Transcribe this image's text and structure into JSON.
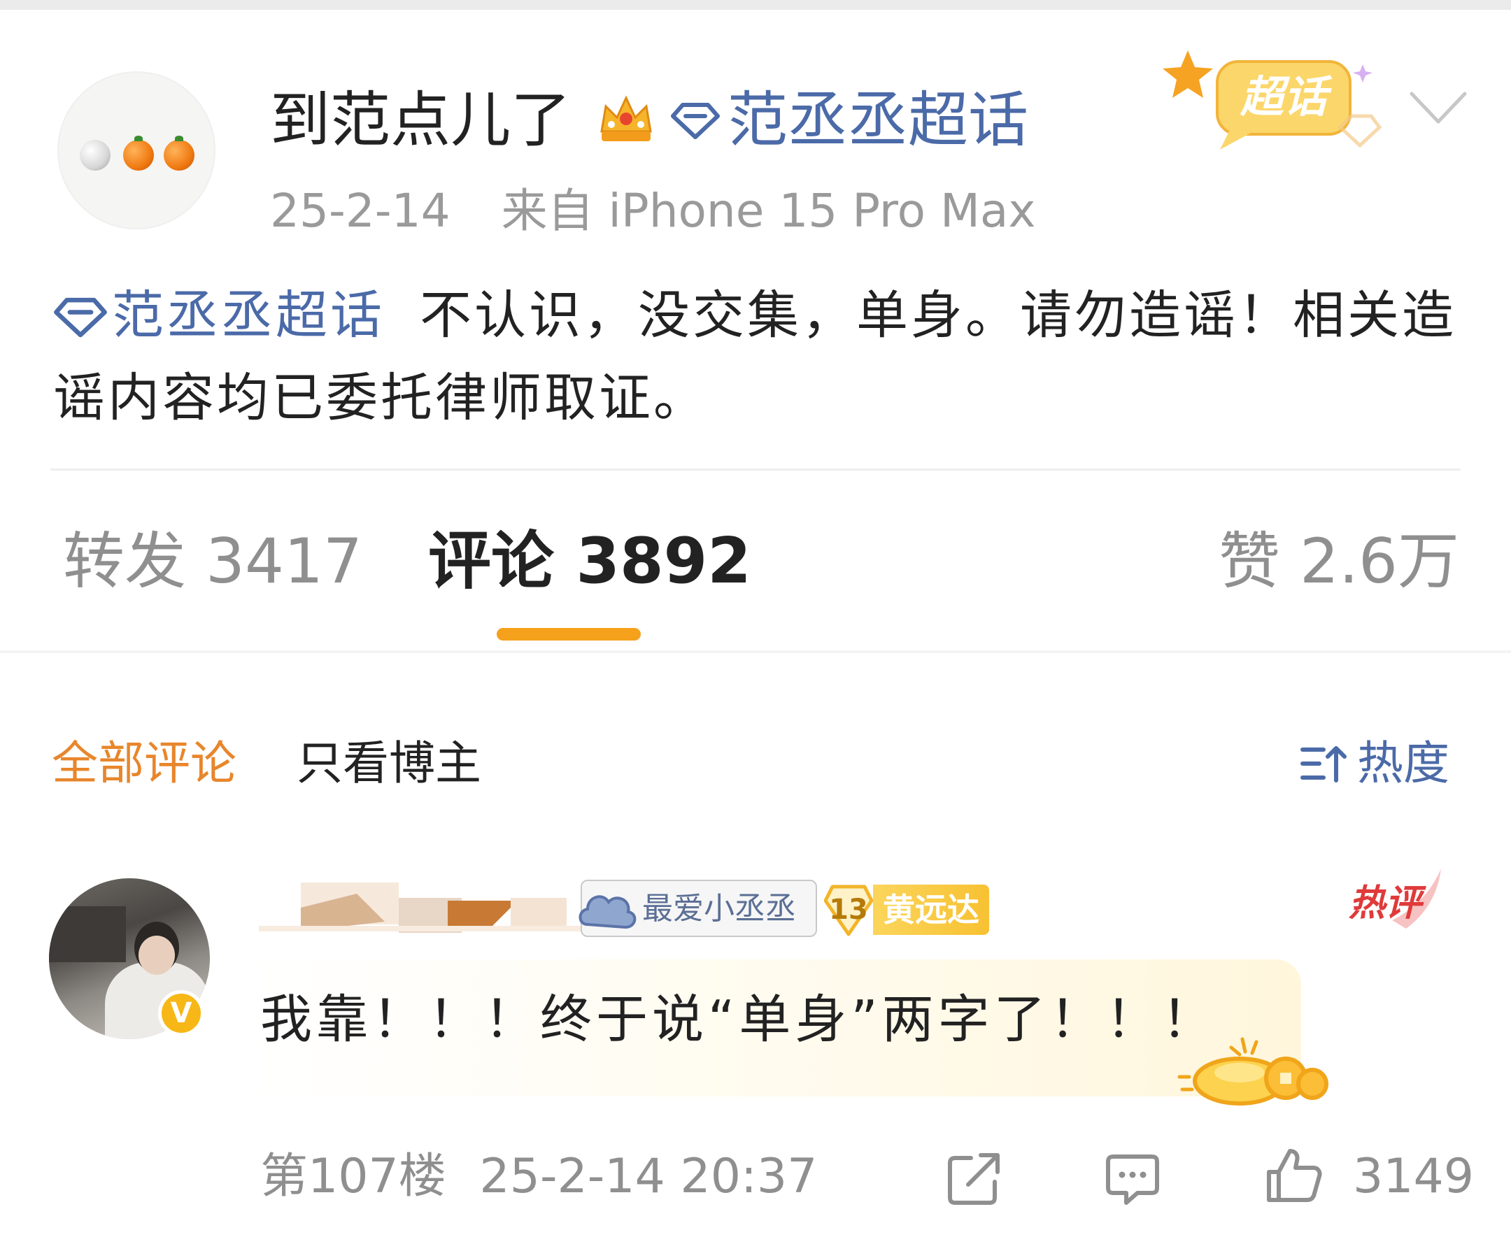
{
  "post": {
    "username": "到范点儿了",
    "topic": "范丞丞超话",
    "chaohua_badge": "超话",
    "date": "25-2-14",
    "source": "来自 iPhone 15 Pro Max",
    "body_topic": "范丞丞超话",
    "body_text": "不认识，没交集，单身。请勿造谣！相关造谣内容均已委托律师取证。"
  },
  "counts": {
    "repost_label": "转发",
    "repost_value": "3417",
    "comment_label": "评论",
    "comment_value": "3892",
    "like_label": "赞",
    "like_value": "2.6万",
    "active_tab": "评论",
    "accent_color": "#f5a11c"
  },
  "filters": {
    "all": "全部评论",
    "owner_only": "只看博主",
    "sort": "热度"
  },
  "comment": {
    "fan_badge": "最爱小丞丞",
    "level": "13",
    "level_name": "黄远达",
    "hot_tag": "热评",
    "verified_mark": "V",
    "text": "我靠！！！终于说“单身”两字了！！！",
    "floor": "第107楼",
    "time": "25-2-14 20:37",
    "likes": "3149"
  },
  "icons": [
    "crown-icon",
    "diamond-topic-icon",
    "chevron-down-icon",
    "sort-icon",
    "share-icon",
    "reply-icon",
    "like-icon",
    "cloud-icon",
    "gold-ingot-icon"
  ],
  "colors": {
    "topic_blue": "#4b6aa8",
    "orange_active": "#e8862b",
    "hot_red": "#e03a3a",
    "gray_text": "#8f8f8f"
  }
}
